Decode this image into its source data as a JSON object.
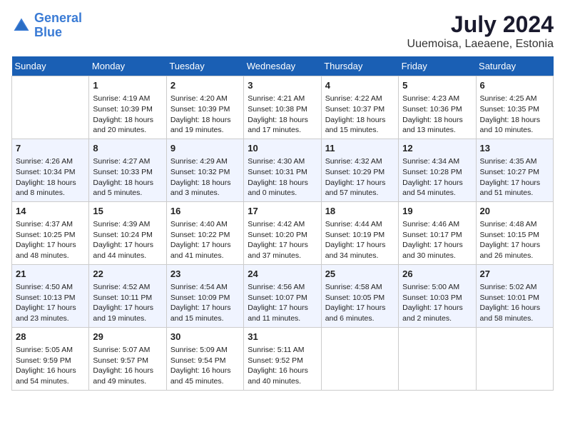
{
  "header": {
    "logo_line1": "General",
    "logo_line2": "Blue",
    "month": "July 2024",
    "location": "Uuemoisa, Laeaene, Estonia"
  },
  "weekdays": [
    "Sunday",
    "Monday",
    "Tuesday",
    "Wednesday",
    "Thursday",
    "Friday",
    "Saturday"
  ],
  "weeks": [
    [
      {
        "day": "",
        "text": ""
      },
      {
        "day": "1",
        "text": "Sunrise: 4:19 AM\nSunset: 10:39 PM\nDaylight: 18 hours\nand 20 minutes."
      },
      {
        "day": "2",
        "text": "Sunrise: 4:20 AM\nSunset: 10:39 PM\nDaylight: 18 hours\nand 19 minutes."
      },
      {
        "day": "3",
        "text": "Sunrise: 4:21 AM\nSunset: 10:38 PM\nDaylight: 18 hours\nand 17 minutes."
      },
      {
        "day": "4",
        "text": "Sunrise: 4:22 AM\nSunset: 10:37 PM\nDaylight: 18 hours\nand 15 minutes."
      },
      {
        "day": "5",
        "text": "Sunrise: 4:23 AM\nSunset: 10:36 PM\nDaylight: 18 hours\nand 13 minutes."
      },
      {
        "day": "6",
        "text": "Sunrise: 4:25 AM\nSunset: 10:35 PM\nDaylight: 18 hours\nand 10 minutes."
      }
    ],
    [
      {
        "day": "7",
        "text": "Sunrise: 4:26 AM\nSunset: 10:34 PM\nDaylight: 18 hours\nand 8 minutes."
      },
      {
        "day": "8",
        "text": "Sunrise: 4:27 AM\nSunset: 10:33 PM\nDaylight: 18 hours\nand 5 minutes."
      },
      {
        "day": "9",
        "text": "Sunrise: 4:29 AM\nSunset: 10:32 PM\nDaylight: 18 hours\nand 3 minutes."
      },
      {
        "day": "10",
        "text": "Sunrise: 4:30 AM\nSunset: 10:31 PM\nDaylight: 18 hours\nand 0 minutes."
      },
      {
        "day": "11",
        "text": "Sunrise: 4:32 AM\nSunset: 10:29 PM\nDaylight: 17 hours\nand 57 minutes."
      },
      {
        "day": "12",
        "text": "Sunrise: 4:34 AM\nSunset: 10:28 PM\nDaylight: 17 hours\nand 54 minutes."
      },
      {
        "day": "13",
        "text": "Sunrise: 4:35 AM\nSunset: 10:27 PM\nDaylight: 17 hours\nand 51 minutes."
      }
    ],
    [
      {
        "day": "14",
        "text": "Sunrise: 4:37 AM\nSunset: 10:25 PM\nDaylight: 17 hours\nand 48 minutes."
      },
      {
        "day": "15",
        "text": "Sunrise: 4:39 AM\nSunset: 10:24 PM\nDaylight: 17 hours\nand 44 minutes."
      },
      {
        "day": "16",
        "text": "Sunrise: 4:40 AM\nSunset: 10:22 PM\nDaylight: 17 hours\nand 41 minutes."
      },
      {
        "day": "17",
        "text": "Sunrise: 4:42 AM\nSunset: 10:20 PM\nDaylight: 17 hours\nand 37 minutes."
      },
      {
        "day": "18",
        "text": "Sunrise: 4:44 AM\nSunset: 10:19 PM\nDaylight: 17 hours\nand 34 minutes."
      },
      {
        "day": "19",
        "text": "Sunrise: 4:46 AM\nSunset: 10:17 PM\nDaylight: 17 hours\nand 30 minutes."
      },
      {
        "day": "20",
        "text": "Sunrise: 4:48 AM\nSunset: 10:15 PM\nDaylight: 17 hours\nand 26 minutes."
      }
    ],
    [
      {
        "day": "21",
        "text": "Sunrise: 4:50 AM\nSunset: 10:13 PM\nDaylight: 17 hours\nand 23 minutes."
      },
      {
        "day": "22",
        "text": "Sunrise: 4:52 AM\nSunset: 10:11 PM\nDaylight: 17 hours\nand 19 minutes."
      },
      {
        "day": "23",
        "text": "Sunrise: 4:54 AM\nSunset: 10:09 PM\nDaylight: 17 hours\nand 15 minutes."
      },
      {
        "day": "24",
        "text": "Sunrise: 4:56 AM\nSunset: 10:07 PM\nDaylight: 17 hours\nand 11 minutes."
      },
      {
        "day": "25",
        "text": "Sunrise: 4:58 AM\nSunset: 10:05 PM\nDaylight: 17 hours\nand 6 minutes."
      },
      {
        "day": "26",
        "text": "Sunrise: 5:00 AM\nSunset: 10:03 PM\nDaylight: 17 hours\nand 2 minutes."
      },
      {
        "day": "27",
        "text": "Sunrise: 5:02 AM\nSunset: 10:01 PM\nDaylight: 16 hours\nand 58 minutes."
      }
    ],
    [
      {
        "day": "28",
        "text": "Sunrise: 5:05 AM\nSunset: 9:59 PM\nDaylight: 16 hours\nand 54 minutes."
      },
      {
        "day": "29",
        "text": "Sunrise: 5:07 AM\nSunset: 9:57 PM\nDaylight: 16 hours\nand 49 minutes."
      },
      {
        "day": "30",
        "text": "Sunrise: 5:09 AM\nSunset: 9:54 PM\nDaylight: 16 hours\nand 45 minutes."
      },
      {
        "day": "31",
        "text": "Sunrise: 5:11 AM\nSunset: 9:52 PM\nDaylight: 16 hours\nand 40 minutes."
      },
      {
        "day": "",
        "text": ""
      },
      {
        "day": "",
        "text": ""
      },
      {
        "day": "",
        "text": ""
      }
    ]
  ]
}
